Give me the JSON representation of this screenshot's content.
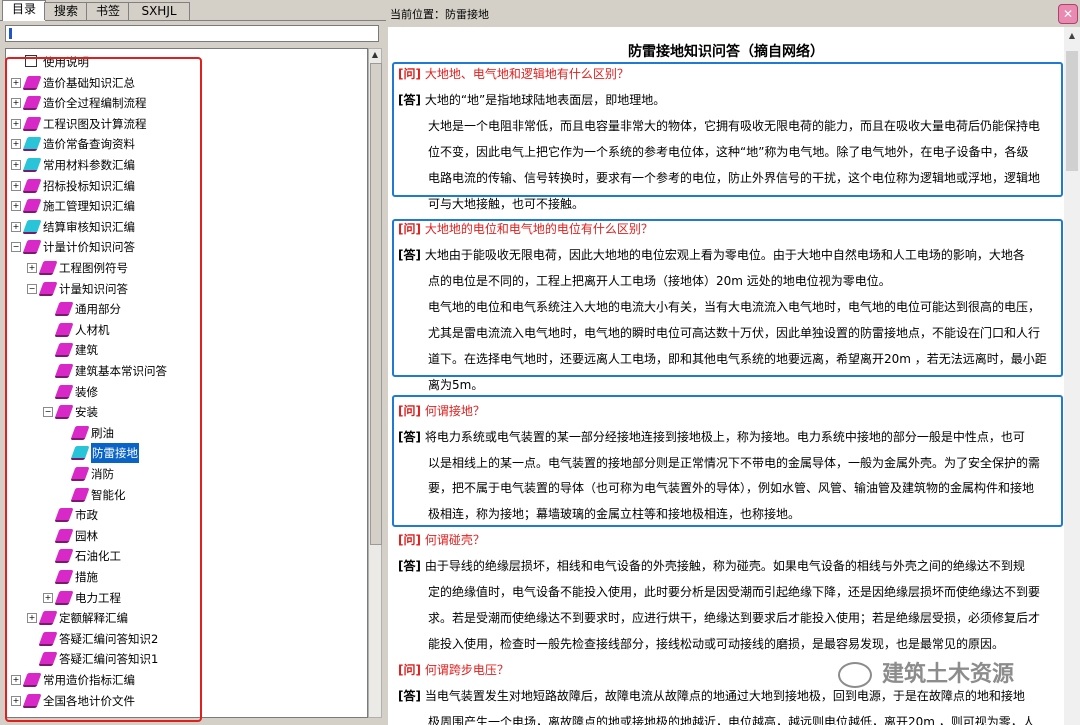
{
  "tabs": [
    "目录",
    "搜索",
    "书签",
    "SXHJL"
  ],
  "search": {
    "value": ""
  },
  "tree": [
    {
      "label": "使用说明",
      "level": 0,
      "exp": "",
      "icon": "info"
    },
    {
      "label": "造价基础知识汇总",
      "level": 0,
      "exp": "+",
      "icon": "book-magenta"
    },
    {
      "label": "造价全过程编制流程",
      "level": 0,
      "exp": "+",
      "icon": "book-magenta"
    },
    {
      "label": "工程识图及计算流程",
      "level": 0,
      "exp": "+",
      "icon": "book-magenta"
    },
    {
      "label": "造价常备查询资料",
      "level": 0,
      "exp": "+",
      "icon": "book-cyan"
    },
    {
      "label": "常用材料参数汇编",
      "level": 0,
      "exp": "+",
      "icon": "book-cyan"
    },
    {
      "label": "招标投标知识汇编",
      "level": 0,
      "exp": "+",
      "icon": "book-magenta"
    },
    {
      "label": "施工管理知识汇编",
      "level": 0,
      "exp": "+",
      "icon": "book-magenta"
    },
    {
      "label": "结算审核知识汇编",
      "level": 0,
      "exp": "+",
      "icon": "book-cyan"
    },
    {
      "label": "计量计价知识问答",
      "level": 0,
      "exp": "−",
      "icon": "book-magenta"
    },
    {
      "label": "工程图例符号",
      "level": 1,
      "exp": "+",
      "icon": "book-magenta"
    },
    {
      "label": "计量知识问答",
      "level": 1,
      "exp": "−",
      "icon": "book-magenta"
    },
    {
      "label": "通用部分",
      "level": 2,
      "exp": "",
      "icon": "book-magenta"
    },
    {
      "label": "人材机",
      "level": 2,
      "exp": "",
      "icon": "book-magenta"
    },
    {
      "label": "建筑",
      "level": 2,
      "exp": "",
      "icon": "book-magenta"
    },
    {
      "label": "建筑基本常识问答",
      "level": 2,
      "exp": "",
      "icon": "book-magenta"
    },
    {
      "label": "装修",
      "level": 2,
      "exp": "",
      "icon": "book-magenta"
    },
    {
      "label": "安装",
      "level": 2,
      "exp": "−",
      "icon": "book-magenta"
    },
    {
      "label": "刷油",
      "level": 3,
      "exp": "",
      "icon": "book-magenta"
    },
    {
      "label": "防雷接地",
      "level": 3,
      "exp": "",
      "icon": "book-cyan",
      "selected": true
    },
    {
      "label": "消防",
      "level": 3,
      "exp": "",
      "icon": "book-magenta"
    },
    {
      "label": "智能化",
      "level": 3,
      "exp": "",
      "icon": "book-magenta"
    },
    {
      "label": "市政",
      "level": 2,
      "exp": "",
      "icon": "book-magenta"
    },
    {
      "label": "园林",
      "level": 2,
      "exp": "",
      "icon": "book-magenta"
    },
    {
      "label": "石油化工",
      "level": 2,
      "exp": "",
      "icon": "book-magenta"
    },
    {
      "label": "措施",
      "level": 2,
      "exp": "",
      "icon": "book-magenta"
    },
    {
      "label": "电力工程",
      "level": 2,
      "exp": "+",
      "icon": "book-magenta"
    },
    {
      "label": "定额解释汇编",
      "level": 1,
      "exp": "+",
      "icon": "book-magenta"
    },
    {
      "label": "答疑汇编问答知识2",
      "level": 1,
      "exp": "",
      "icon": "book-magenta"
    },
    {
      "label": "答疑汇编问答知识1",
      "level": 1,
      "exp": "",
      "icon": "book-magenta"
    },
    {
      "label": "常用造价指标汇编",
      "level": 0,
      "exp": "+",
      "icon": "book-magenta"
    },
    {
      "label": "全国各地计价文件",
      "level": 0,
      "exp": "+",
      "icon": "book-magenta"
    }
  ],
  "breadcrumb": "当前位置：防雷接地",
  "article": {
    "title": "防雷接地知识问答（摘自网络）",
    "lines": [
      {
        "type": "q",
        "tag": "[问]",
        "text": "大地地、电气地和逻辑地有什么区别？"
      },
      {
        "type": "a",
        "tag": "[答]",
        "text": "大地的“地”是指地球陆地表面层，即地理地。"
      },
      {
        "type": "p",
        "text": "大地是一个电阻非常低，而且电容量非常大的物体，它拥有吸收无限电荷的能力，而且在吸收大量电荷后仍能保持电"
      },
      {
        "type": "p",
        "text": "位不变，因此电气上把它作为一个系统的参考电位体，这种“地”称为电气地。除了电气地外，在电子设备中，各级"
      },
      {
        "type": "p",
        "text": "电路电流的传输、信号转换时，要求有一个参考的电位，防止外界信号的干扰，这个电位称为逻辑地或浮地，逻辑地"
      },
      {
        "type": "p",
        "text": "可与大地接触，也可不接触。"
      },
      {
        "type": "q",
        "tag": "[问]",
        "text": "大地地的电位和电气地的电位有什么区别？"
      },
      {
        "type": "a",
        "tag": "[答]",
        "text": "大地由于能吸收无限电荷，因此大地地的电位宏观上看为零电位。由于大地中自然电场和人工电场的影响，大地各"
      },
      {
        "type": "p",
        "text": "点的电位是不同的，工程上把离开人工电场（接地体）20m 远处的地电位视为零电位。"
      },
      {
        "type": "p",
        "text": "电气地的电位和电气系统注入大地的电流大小有关，当有大电流流入电气地时，电气地的电位可能达到很高的电压，"
      },
      {
        "type": "p",
        "text": "尤其是雷电流流入电气地时，电气地的瞬时电位可高达数十万伏，因此单独设置的防雷接地点，不能设在门口和人行"
      },
      {
        "type": "p",
        "text": "道下。在选择电气地时，还要远离人工电场，即和其他电气系统的地要远离，希望离开20m ，若无法远离时，最小距"
      },
      {
        "type": "p",
        "text": "离为5m。"
      },
      {
        "type": "q",
        "tag": "[问]",
        "text": "何谓接地？"
      },
      {
        "type": "a",
        "tag": "[答]",
        "text": "将电力系统或电气装置的某一部分经接地连接到接地极上，称为接地。电力系统中接地的部分一般是中性点，也可"
      },
      {
        "type": "p",
        "text": "以是相线上的某一点。电气装置的接地部分则是正常情况下不带电的金属导体，一般为金属外壳。为了安全保护的需"
      },
      {
        "type": "p",
        "text": "要，把不属于电气装置的导体（也可称为电气装置外的导体），例如水管、风管、输油管及建筑物的金属构件和接地"
      },
      {
        "type": "p",
        "text": "极相连，称为接地；幕墙玻璃的金属立柱等和接地极相连，也称接地。"
      },
      {
        "type": "q",
        "tag": "[问]",
        "text": "何谓碰壳？"
      },
      {
        "type": "a",
        "tag": "[答]",
        "text": "由于导线的绝缘层损坏，相线和电气设备的外壳接触，称为碰壳。如果电气设备的相线与外壳之间的绝缘达不到规"
      },
      {
        "type": "p",
        "text": "定的绝缘值时，电气设备不能投入使用，此时要分析是因受潮而引起绝缘下降，还是因绝缘层损坏而使绝缘达不到要"
      },
      {
        "type": "p",
        "text": "求。若是受潮而使绝缘达不到要求时，应进行烘干，绝缘达到要求后才能投入使用；若是绝缘层受损，必须修复后才"
      },
      {
        "type": "p",
        "text": "能投入使用，检查时一般先检查接线部分，接线松动或可动接线的磨损，是最容易发现，也是最常见的原因。"
      },
      {
        "type": "q",
        "tag": "[问]",
        "text": "何谓跨步电压？"
      },
      {
        "type": "a",
        "tag": "[答]",
        "text": "当电气装置发生对地短路故障后，故障电流从故障点的地通过大地到接地极，回到电源，于是在故障点的地和接地"
      },
      {
        "type": "p",
        "text": "极周围产生一个电场，离故障点的地或接地极的地越近，电位越高，越远则电位越低，离开20m ，则可视为零，人"
      }
    ]
  },
  "watermark": "建筑土木资源"
}
